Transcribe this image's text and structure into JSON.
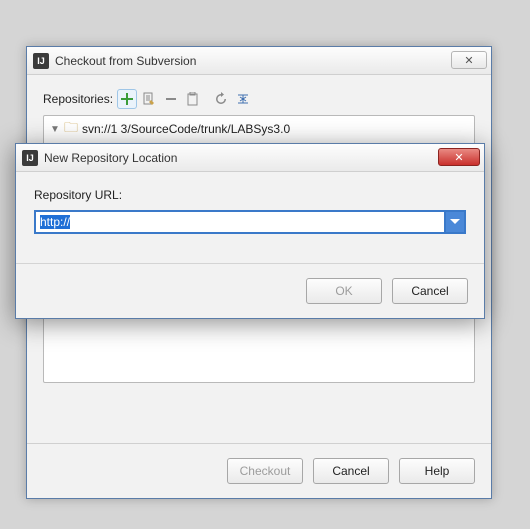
{
  "main": {
    "title": "Checkout from Subversion",
    "repos_label": "Repositories:",
    "tree_entry": "svn://1            3/SourceCode/trunk/LABSys3.0",
    "checkout_label": "Checkout",
    "cancel_label": "Cancel",
    "help_label": "Help"
  },
  "modal": {
    "title": "New Repository Location",
    "url_label": "Repository URL:",
    "url_value": "http://",
    "ok_label": "OK",
    "cancel_label": "Cancel"
  }
}
